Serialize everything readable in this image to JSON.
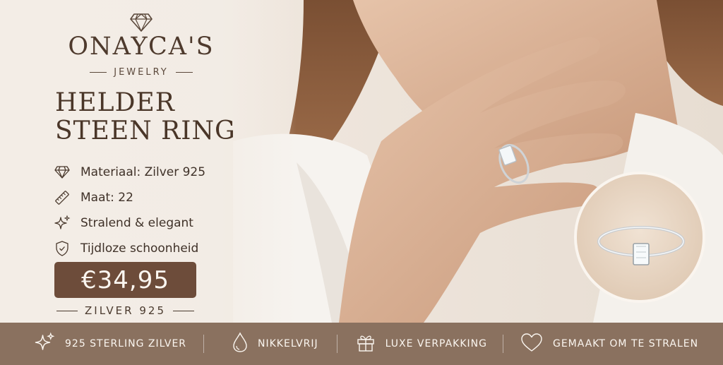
{
  "brand": {
    "name": "ONAYCA'S",
    "subtitle": "JEWELRY"
  },
  "product": {
    "title_line1": "HELDER",
    "title_line2": "STEEN RING",
    "price": "€34,95",
    "metal_label": "ZILVER 925"
  },
  "features": [
    {
      "icon": "diamond-icon",
      "label": "Materiaal: Zilver 925"
    },
    {
      "icon": "ruler-icon",
      "label": "Maat: 22"
    },
    {
      "icon": "sparkle-icon",
      "label": "Stralend & elegant"
    },
    {
      "icon": "shield-icon",
      "label": "Tijdloze schoonheid"
    }
  ],
  "bottom_bar": [
    {
      "icon": "sparkle-icon",
      "label": "925 STERLING ZILVER"
    },
    {
      "icon": "drop-icon",
      "label": "NIKKELVRIJ"
    },
    {
      "icon": "gift-icon",
      "label": "LUXE VERPAKKING"
    },
    {
      "icon": "heart-icon",
      "label": "GEMAAKT OM TE STRALEN"
    }
  ],
  "colors": {
    "background": "#f3ede6",
    "price_box": "#6d4c3a",
    "bottom_bar": "#8a715f",
    "text_dark": "#4a3628"
  }
}
